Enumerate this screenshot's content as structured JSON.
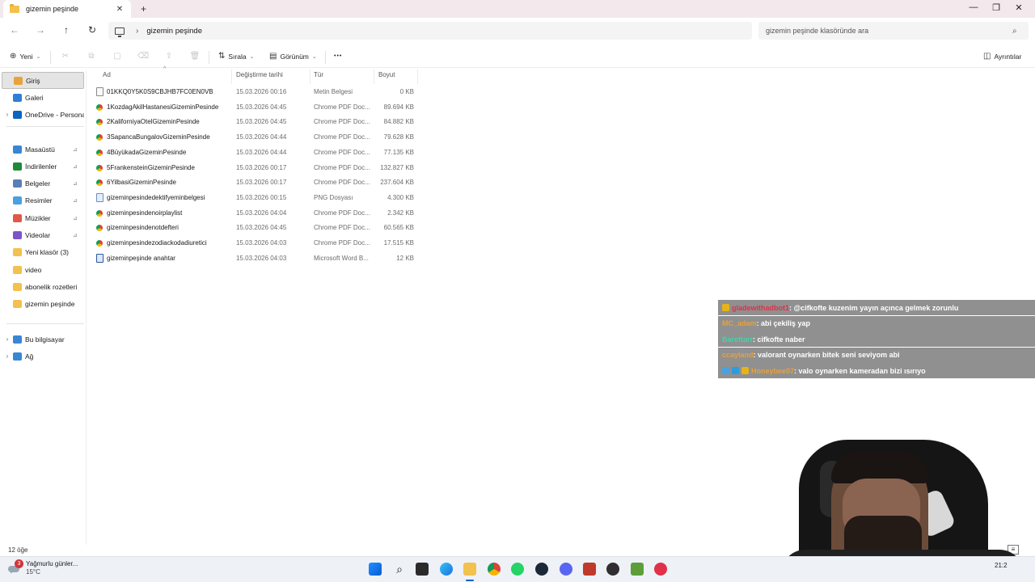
{
  "window": {
    "tab_title": "gizemin peşinde",
    "tab_close_glyph": "✕",
    "tab_add_glyph": "+",
    "minimize_glyph": "—",
    "maximize_glyph": "❐",
    "close_glyph": "✕"
  },
  "address": {
    "back_glyph": "←",
    "forward_glyph": "→",
    "up_glyph": "↑",
    "refresh_glyph": "↻",
    "separator": "›",
    "crumb": "gizemin peşinde",
    "search_placeholder": "gizemin peşinde klasöründe ara"
  },
  "toolbar": {
    "new_label": "Yeni",
    "sort_label": "Sırala",
    "view_label": "Görünüm",
    "more_glyph": "•••",
    "details_label": "Ayrıntılar"
  },
  "sidebar": {
    "top": [
      {
        "label": "Giriş",
        "icon": "home-icon",
        "color": "#e8a33d"
      },
      {
        "label": "Galeri",
        "icon": "gallery-icon",
        "color": "#2f7ed8"
      },
      {
        "label": "OneDrive - Persona",
        "icon": "cloud-icon",
        "color": "#0a64c2"
      }
    ],
    "quick": [
      {
        "label": "Masaüstü",
        "icon": "desktop-icon",
        "color": "#3a86d4"
      },
      {
        "label": "İndirilenler",
        "icon": "download-icon",
        "color": "#1f8a3a"
      },
      {
        "label": "Belgeler",
        "icon": "documents-icon",
        "color": "#5a7fb5"
      },
      {
        "label": "Resimler",
        "icon": "pictures-icon",
        "color": "#4aa0e0"
      },
      {
        "label": "Müzikler",
        "icon": "music-icon",
        "color": "#e0584a"
      },
      {
        "label": "Videolar",
        "icon": "videos-icon",
        "color": "#7b56c9"
      },
      {
        "label": "Yeni klasör (3)",
        "icon": "folder-icon",
        "color": "#f2c14e"
      },
      {
        "label": "video",
        "icon": "folder-icon",
        "color": "#f2c14e"
      },
      {
        "label": "abonelik rozetleri",
        "icon": "folder-icon",
        "color": "#f2c14e"
      },
      {
        "label": "gizemin peşinde",
        "icon": "folder-icon",
        "color": "#f2c14e"
      }
    ],
    "bottom": [
      {
        "label": "Bu bilgisayar",
        "icon": "pc-icon",
        "color": "#3a86d4"
      },
      {
        "label": "Ağ",
        "icon": "network-icon",
        "color": "#3a86d4"
      }
    ],
    "expander_glyph": "›",
    "pin_glyph": "📌"
  },
  "columns": {
    "name": "Ad",
    "modified": "Değiştirme tarihi",
    "type": "Tür",
    "size": "Boyut",
    "sort_caret": "^"
  },
  "files": [
    {
      "name": "01KKQ0Y5K0S9CBJHB7FC0EN0VB",
      "modified": "15.03.2026 00:16",
      "type": "Metin Belgesi",
      "size": "0 KB",
      "kind": "txt"
    },
    {
      "name": "1KozdagAkilHastanesiGizeminPesinde",
      "modified": "15.03.2026 04:45",
      "type": "Chrome PDF Doc...",
      "size": "89.694 KB",
      "kind": "pdf"
    },
    {
      "name": "2KaliforniyaOtelGizeminPesinde",
      "modified": "15.03.2026 04:45",
      "type": "Chrome PDF Doc...",
      "size": "84.882 KB",
      "kind": "pdf"
    },
    {
      "name": "3SapancaBungalovGizeminPesinde",
      "modified": "15.03.2026 04:44",
      "type": "Chrome PDF Doc...",
      "size": "79.628 KB",
      "kind": "pdf"
    },
    {
      "name": "4BüyükadaGizeminPesinde",
      "modified": "15.03.2026 04:44",
      "type": "Chrome PDF Doc...",
      "size": "77.135 KB",
      "kind": "pdf"
    },
    {
      "name": "5FrankensteinGizeminPesinde",
      "modified": "15.03.2026 00:17",
      "type": "Chrome PDF Doc...",
      "size": "132.827 KB",
      "kind": "pdf"
    },
    {
      "name": "6YilbasiGizeminPesinde",
      "modified": "15.03.2026 00:17",
      "type": "Chrome PDF Doc...",
      "size": "237.604 KB",
      "kind": "pdf"
    },
    {
      "name": "gizeminpesindedektifyeminbelgesi",
      "modified": "15.03.2026 00:15",
      "type": "PNG Dosyası",
      "size": "4.300 KB",
      "kind": "png"
    },
    {
      "name": "gizeminpesindenoirplaylist",
      "modified": "15.03.2026 04:04",
      "type": "Chrome PDF Doc...",
      "size": "2.342 KB",
      "kind": "pdf"
    },
    {
      "name": "gizeminpesindenotdefteri",
      "modified": "15.03.2026 04:45",
      "type": "Chrome PDF Doc...",
      "size": "60.565 KB",
      "kind": "pdf"
    },
    {
      "name": "gizeminpesindezodiackodadiuretici",
      "modified": "15.03.2026 04:03",
      "type": "Chrome PDF Doc...",
      "size": "17.515 KB",
      "kind": "pdf"
    },
    {
      "name": "gizeminpeşinde anahtar",
      "modified": "15.03.2026 04:03",
      "type": "Microsoft Word B...",
      "size": "12 KB",
      "kind": "doc"
    }
  ],
  "status": {
    "item_count": "12 öğe"
  },
  "chat": [
    {
      "user": "gladewithadbot1",
      "user_color": "#e0304a",
      "message": " : @cifkofte kuzenim yayın açınca gelmek zorunlu",
      "badges": [
        "#e7b416"
      ]
    },
    {
      "user": "MC_adam",
      "user_color": "#e8a03a",
      "message": " : abi çekiliş yap",
      "badges": []
    },
    {
      "user": "Barettarr",
      "user_color": "#3dd6a8",
      "message": " : cifkofte naber",
      "badges": []
    },
    {
      "user": "ccayland",
      "user_color": "#e8a03a",
      "message": " : valorant oynarken bitek seni seviyom abi",
      "badges": []
    },
    {
      "user": "Honeybee07",
      "user_color": "#e8a03a",
      "message": " : valo oynarken kameradan bizi ısırıyo",
      "badges": [
        "#4aa0e0",
        "#2d9cdb",
        "#e7b416"
      ]
    }
  ],
  "taskbar": {
    "weather_text": "Yağmurlu günler...",
    "weather_temp": "15°C",
    "weather_badge": "3",
    "clock": "21:2"
  },
  "colors": {
    "accent": "#0067c0",
    "selection_bg": "#e4e4e4",
    "chat_bg": "#787878"
  }
}
